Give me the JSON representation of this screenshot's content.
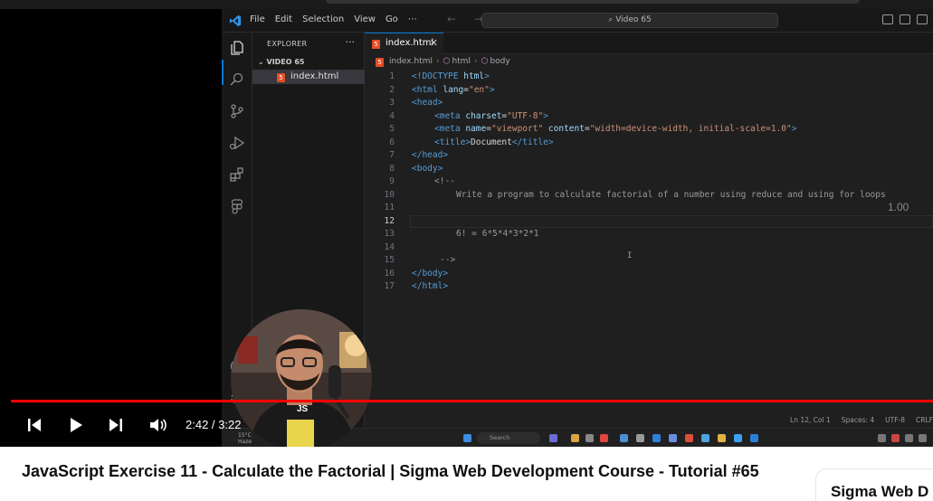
{
  "vscode": {
    "menu": [
      "File",
      "Edit",
      "Selection",
      "View",
      "Go",
      "⋯"
    ],
    "nav_arrows": "← →",
    "command_center": "Video 65",
    "explorer_title": "EXPLORER",
    "explorer_more": "···",
    "folder": "VIDEO 65",
    "file": "index.html",
    "tab_label": "index.html",
    "tab_close": "✕",
    "breadcrumb": [
      "index.html",
      "html",
      "body"
    ],
    "lines": [
      {
        "n": "1"
      },
      {
        "n": "2"
      },
      {
        "n": "3"
      },
      {
        "n": "4"
      },
      {
        "n": "5"
      },
      {
        "n": "6"
      },
      {
        "n": "7"
      },
      {
        "n": "8"
      },
      {
        "n": "9"
      },
      {
        "n": "10"
      },
      {
        "n": "11"
      },
      {
        "n": "12"
      },
      {
        "n": "13"
      },
      {
        "n": "14"
      },
      {
        "n": "15"
      },
      {
        "n": "16"
      },
      {
        "n": "17"
      }
    ],
    "current_line": 12,
    "code": {
      "l1_doctype": "<!DOCTYPE",
      "l1_html": "html",
      "l2_open": "<html",
      "l2_attr": "lang",
      "l2_val": "\"en\"",
      "l3": "<head>",
      "l4_tag": "<meta",
      "l4_attr": "charset",
      "l4_val": "\"UTF-8\"",
      "l5_tag": "<meta",
      "l5_attr1": "name",
      "l5_val1": "\"viewport\"",
      "l5_attr2": "content",
      "l5_val2": "\"width=device-width, initial-scale=1.0\"",
      "l6_open": "<title>",
      "l6_text": "Document",
      "l6_close": "</title>",
      "l7": "</head>",
      "l8": "<body>",
      "l9": "<!--",
      "l10": "Write a program to calculate factorial of a number using reduce and using for loops",
      "l13": "6! = 6*5*4*3*2*1",
      "l15": "-->",
      "l16": "</body>",
      "l17": "</html>"
    },
    "playback_speed": "1.00",
    "status_items": [
      "Ln 12, Col 1",
      "Spaces: 4",
      "UTF-8",
      "CRLF"
    ],
    "taskbar_search": "Search",
    "weather": [
      "15°C",
      "Haze"
    ]
  },
  "player": {
    "progress_fraction": 0.82,
    "time_current": "2:42",
    "time_total": "3:22",
    "time_display": "2:42 / 3:22",
    "icons": [
      "previous-icon",
      "play-icon",
      "next-icon",
      "volume-icon"
    ],
    "accent": "#ff0000"
  },
  "video": {
    "title": "JavaScript Exercise 11 - Calculate the Factorial | Sigma Web Development Course - Tutorial #65",
    "channel": "Sigma Web D"
  },
  "webcam_logo": "JS"
}
